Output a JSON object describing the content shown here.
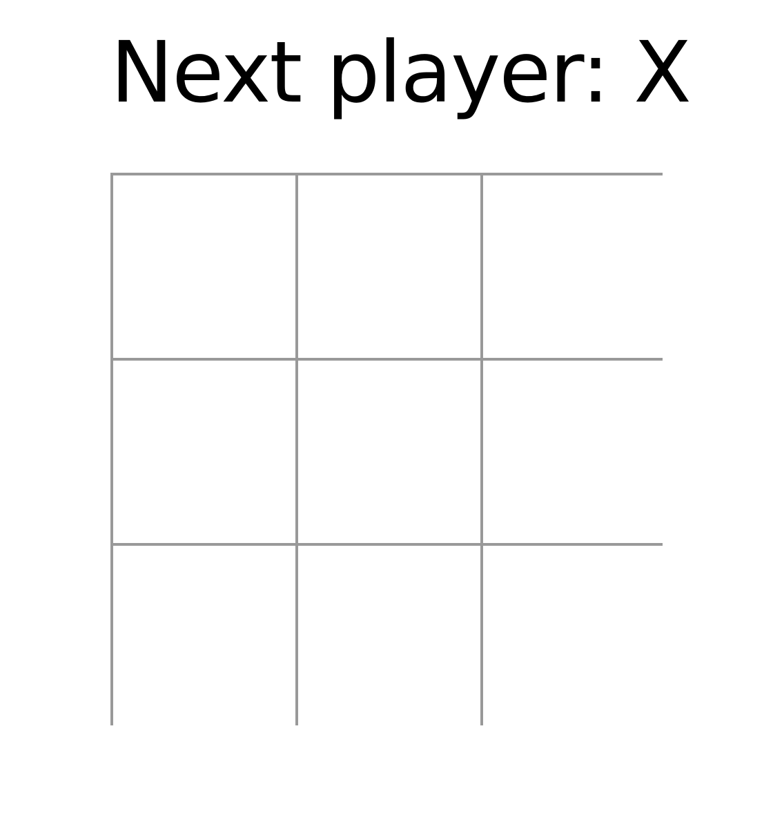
{
  "status": {
    "text": "Next player: X"
  },
  "board": {
    "squares": [
      "",
      "",
      "",
      "",
      "",
      "",
      "",
      "",
      ""
    ],
    "grid_color": "#999999",
    "square_color": "#ffffff"
  }
}
